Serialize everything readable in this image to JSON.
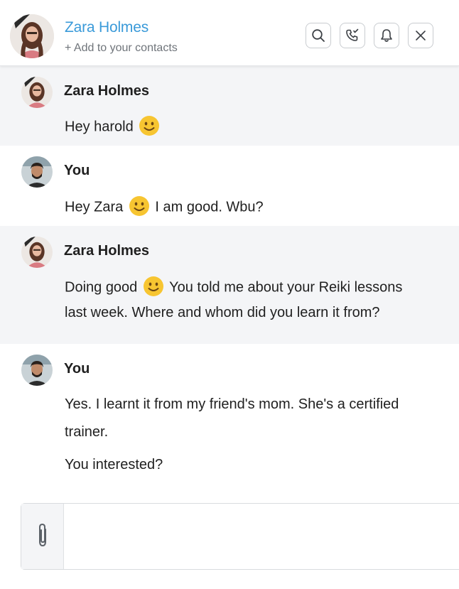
{
  "header": {
    "contact_name": "Zara Holmes",
    "add_contact_label": "+ Add to your contacts",
    "buttons": [
      {
        "icon": "search-icon"
      },
      {
        "icon": "phone-icon"
      },
      {
        "icon": "bell-icon"
      },
      {
        "icon": "close-icon"
      }
    ]
  },
  "messages": [
    {
      "sender": "Zara Holmes",
      "lines": [
        {
          "before": "Hey harold",
          "emoji": "smiley-emoji",
          "after": ""
        }
      ]
    },
    {
      "sender": "You",
      "lines": [
        {
          "before": "Hey Zara",
          "emoji": "smiley-emoji",
          "after": "I am good. Wbu?"
        }
      ]
    },
    {
      "sender": "Zara Holmes",
      "lines": [
        {
          "before": "Doing good",
          "emoji": "smiley-emoji",
          "after": "You told me about your Reiki lessons"
        },
        {
          "text": "last week. Where and whom did you learn it from?"
        }
      ]
    },
    {
      "sender": "You",
      "lines": [
        {
          "text": "Yes. I learnt it from my friend's mom. She's a certified"
        },
        {
          "text": "trainer."
        },
        {
          "text": "You interested?"
        }
      ]
    }
  ],
  "composer": {
    "attach_icon": "paperclip-icon",
    "input_value": ""
  },
  "colors": {
    "accent": "#3a9ad9",
    "incoming_bg": "#f4f5f7",
    "emoji": "#f7c531"
  }
}
